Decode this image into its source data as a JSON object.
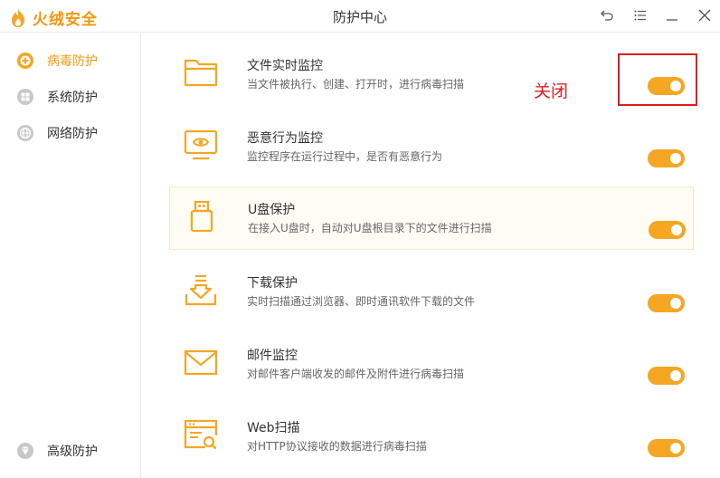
{
  "app": {
    "logo_text": "火绒安全",
    "window_title": "防护中心"
  },
  "window_controls": {
    "back_icon": "back-arrow-icon",
    "menu_icon": "menu-icon",
    "minimize_icon": "minimize-icon",
    "close_icon": "close-icon"
  },
  "sidebar": {
    "items": [
      {
        "label": "病毒防护",
        "icon": "virus-shield-icon",
        "active": true
      },
      {
        "label": "系统防护",
        "icon": "windows-icon",
        "active": false
      },
      {
        "label": "网络防护",
        "icon": "globe-icon",
        "active": false
      },
      {
        "label": "高级防护",
        "icon": "diamond-icon",
        "active": false
      }
    ]
  },
  "protections": [
    {
      "title": "文件实时监控",
      "desc": "当文件被执行、创建、打开时，进行病毒扫描",
      "icon": "folder-icon",
      "enabled": true
    },
    {
      "title": "恶意行为监控",
      "desc": "监控程序在运行过程中，是否有恶意行为",
      "icon": "monitor-eye-icon",
      "enabled": true
    },
    {
      "title": "U盘保护",
      "desc": "在接入U盘时，自动对U盘根目录下的文件进行扫描",
      "icon": "usb-icon",
      "enabled": true
    },
    {
      "title": "下载保护",
      "desc": "实时扫描通过浏览器、即时通讯软件下载的文件",
      "icon": "download-icon",
      "enabled": true
    },
    {
      "title": "邮件监控",
      "desc": "对邮件客户端收发的邮件及附件进行病毒扫描",
      "icon": "mail-icon",
      "enabled": true
    },
    {
      "title": "Web扫描",
      "desc": "对HTTP协议接收的数据进行病毒扫描",
      "icon": "web-scan-icon",
      "enabled": true
    }
  ],
  "annotation": {
    "text": "关闭"
  },
  "colors": {
    "accent": "#f5a623",
    "annotation": "#e21c1c"
  }
}
